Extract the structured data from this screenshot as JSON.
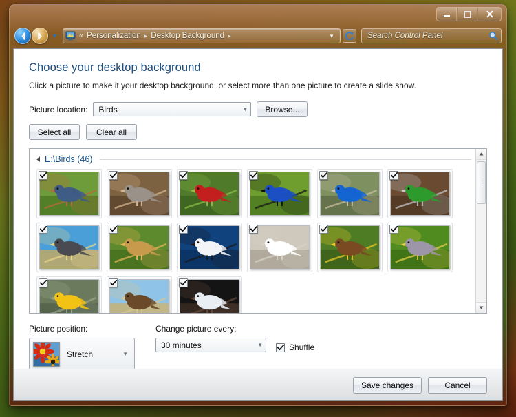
{
  "window": {
    "caption_buttons": [
      {
        "name": "minimize",
        "glyph": "minimize-icon"
      },
      {
        "name": "maximize",
        "glyph": "maximize-icon"
      },
      {
        "name": "close",
        "glyph": "close-icon"
      }
    ]
  },
  "nav": {
    "back_icon": "back-arrow-icon",
    "forward_icon": "forward-arrow-icon",
    "history_icon": "chevron-down-icon",
    "address_icon": "personalization-monitor-icon",
    "overflow": "«",
    "breadcrumbs": [
      {
        "label": "Personalization"
      },
      {
        "label": "Desktop Background"
      }
    ],
    "crumb_separator": "▸",
    "dropdown_icon": "chevron-down-icon",
    "refresh_icon": "refresh-icon"
  },
  "search": {
    "placeholder": "Search Control Panel",
    "value": "",
    "icon": "search-magnifier-icon"
  },
  "page": {
    "title": "Choose your desktop background",
    "subtitle": "Click a picture to make it your desktop background, or select more than one picture to create a slide show."
  },
  "picture_location": {
    "label": "Picture location:",
    "value": "Birds",
    "browse_label": "Browse..."
  },
  "selection_buttons": {
    "select_all": "Select all",
    "clear_all": "Clear all"
  },
  "gallery": {
    "group_label": "E:\\Birds (46)",
    "collapse_icon": "triangle-collapse-icon",
    "checkbox_icon": "checkmark-icon",
    "scrollbar": {
      "up_icon": "scroll-up-arrow-icon",
      "down_icon": "scroll-down-arrow-icon"
    },
    "thumbnails": [
      {
        "name": "bluebird-on-fence-post",
        "checked": true,
        "sky": "#6f9c3a",
        "ground": "#4d7a24",
        "bird": "#3e5c86",
        "accent": "#b86a3c"
      },
      {
        "name": "tufted-titmouse-on-branch",
        "checked": true,
        "sky": "#7d6242",
        "ground": "#5d472e",
        "bird": "#9a9189",
        "accent": "#d8b894"
      },
      {
        "name": "northern-cardinal-in-tree",
        "checked": true,
        "sky": "#4e7a2a",
        "ground": "#3e6420",
        "bird": "#c31f1f",
        "accent": "#8fbf4a"
      },
      {
        "name": "blue-morpho-butterfly",
        "checked": true,
        "sky": "#6f9e2e",
        "ground": "#4f7a20",
        "bird": "#1b4fc2",
        "accent": "#111111"
      },
      {
        "name": "eastern-bluebird-on-stump",
        "checked": true,
        "sky": "#7e8f60",
        "ground": "#5f6e48",
        "bird": "#1464d2",
        "accent": "#c9bda3"
      },
      {
        "name": "green-and-grey-parrots",
        "checked": true,
        "sky": "#6a4b32",
        "ground": "#4f3824",
        "bird": "#2d9a2d",
        "accent": "#c9c9c9"
      },
      {
        "name": "peregrine-falcon-on-rock",
        "checked": true,
        "sky": "#4b9fd8",
        "ground": "#c2a866",
        "bird": "#4a4a52",
        "accent": "#e8d48a"
      },
      {
        "name": "cedar-waxwing-on-branch",
        "checked": true,
        "sky": "#5d8a2c",
        "ground": "#47701f",
        "bird": "#c79a4c",
        "accent": "#e8b55a"
      },
      {
        "name": "penguin-on-iceberg",
        "checked": true,
        "sky": "#10427e",
        "ground": "#0c3263",
        "bird": "#f2f4f7",
        "accent": "#1a1a1a"
      },
      {
        "name": "white-dove-on-rail",
        "checked": true,
        "sky": "#cfc9bd",
        "ground": "#aaa396",
        "bird": "#ffffff",
        "accent": "#d8d2c6"
      },
      {
        "name": "bird-among-sunflowers",
        "checked": true,
        "sky": "#4e7c24",
        "ground": "#3c611a",
        "bird": "#7a4a22",
        "accent": "#f0cc2a"
      },
      {
        "name": "titmouse-on-green-background",
        "checked": true,
        "sky": "#4f8b1f",
        "ground": "#3e6f16",
        "bird": "#9d95a8",
        "accent": "#e8d24a"
      },
      {
        "name": "yellow-warbler-on-leaves",
        "checked": true,
        "sky": "#6b7a5c",
        "ground": "#53614a",
        "bird": "#f2c214",
        "accent": "#9aa68c"
      },
      {
        "name": "hawk-on-grassland",
        "checked": true,
        "sky": "#8fc4e8",
        "ground": "#c6b276",
        "bird": "#6a4a28",
        "accent": "#d8c48e"
      },
      {
        "name": "gull-against-dark-wall",
        "checked": true,
        "sky": "#141414",
        "ground": "#3a2a22",
        "bird": "#e8eef4",
        "accent": "#6a4a3a"
      }
    ]
  },
  "picture_position": {
    "label": "Picture position:",
    "value": "Stretch",
    "thumbnail_name": "flower-preview-thumbnail"
  },
  "change_picture": {
    "label": "Change picture every:",
    "value": "30 minutes"
  },
  "shuffle": {
    "label": "Shuffle",
    "checked": true
  },
  "footer": {
    "save_label": "Save changes",
    "cancel_label": "Cancel"
  }
}
